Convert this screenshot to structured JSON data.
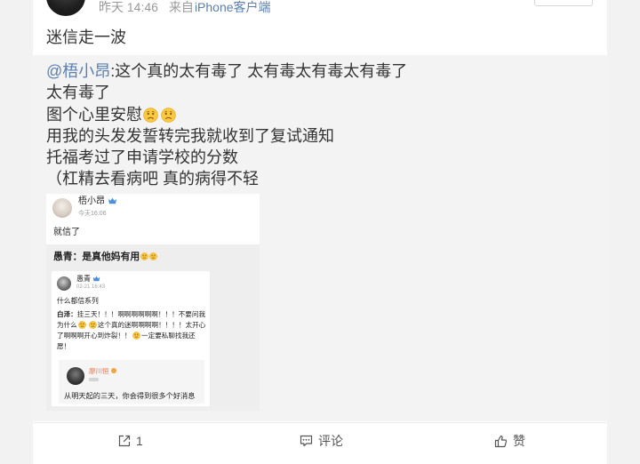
{
  "header": {
    "time": "昨天 14:46",
    "source_prefix": "来自",
    "source_app": "iPhone客户端"
  },
  "post": {
    "text": "迷信走一波"
  },
  "retweet": {
    "mention": "@梧小昂",
    "line1_rest": ":这个真的太有毒了 太有毒太有毒太有毒了",
    "line2": "太有毒了",
    "line3": "图个心里安慰",
    "line4": "用我的头发发誓转完我就收到了复试通知",
    "line5": "托福考过了申请学校的分数",
    "line6": "（杠精去看病吧 真的病得不轻",
    "image": {
      "top_post": {
        "user": "梧小昂",
        "time": "今天16:06",
        "text": "就信了"
      },
      "comment": "愚青：是真他妈有用",
      "inner_post": {
        "user": "愚青",
        "time": "02-21 16:43",
        "text": "什么都信系列",
        "quote_author": "白泽：",
        "quote_text_1": "挂三天！！！啊啊啊啊啊啊！！！不要问我为什么",
        "quote_text_2": "这个真的迷啊啊啊啊！！！！太开心了啊啊啊开心到炸裂！！",
        "quote_text_3": "一定要私聊找我还愿！",
        "nested_post": {
          "user": "廖川恒",
          "text": "从明天起的三天，你会得到很多个好消息"
        }
      }
    }
  },
  "actions": {
    "repost_count": "1",
    "comment_label": "评论",
    "like_label": "赞"
  },
  "icons": {
    "emoji": "sad-face-emoji",
    "repost": "repost-icon",
    "comment": "comment-icon",
    "like": "thumbs-up-icon",
    "badge": "member-badge-icon"
  },
  "colors": {
    "link_blue": "#5b7fb0",
    "text": "#333333",
    "meta_gray": "#999999",
    "retweet_bg": "#f3f3f3",
    "image_bg": "#eeeeee",
    "name_orange": "#eb7350",
    "icon_gray": "#555555"
  }
}
